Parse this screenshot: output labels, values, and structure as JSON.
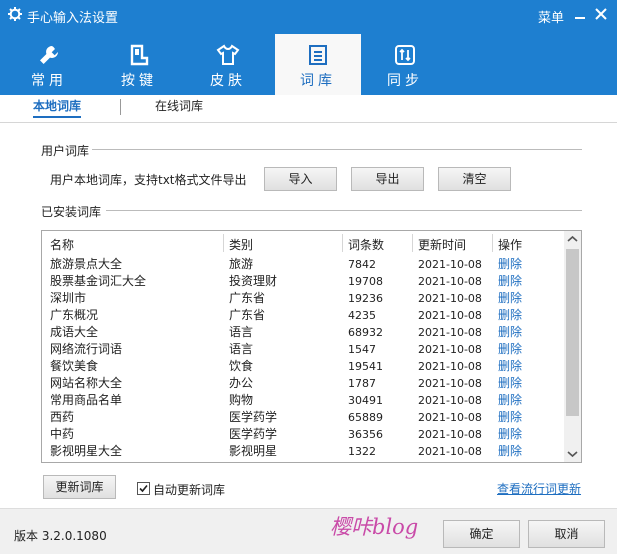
{
  "window": {
    "title": "手心输入法设置",
    "menu_label": "菜单",
    "brand_color": "#1e7fd0",
    "link_color": "#1e6ec0"
  },
  "tabs": [
    {
      "label": "常用",
      "icon": "wrench-icon",
      "active": false
    },
    {
      "label": "按键",
      "icon": "keyboard-icon",
      "active": false
    },
    {
      "label": "皮肤",
      "icon": "shirt-icon",
      "active": false
    },
    {
      "label": "词库",
      "icon": "document-icon",
      "active": true
    },
    {
      "label": "同步",
      "icon": "sync-icon",
      "active": false
    }
  ],
  "subtabs": [
    {
      "label": "本地词库",
      "active": true
    },
    {
      "label": "在线词库",
      "active": false
    }
  ],
  "user_lexicon": {
    "title": "用户词库",
    "description": "用户本地词库，支持txt格式文件导出",
    "import_label": "导入",
    "export_label": "导出",
    "clear_label": "清空"
  },
  "installed": {
    "title": "已安装词库",
    "columns": [
      "名称",
      "类别",
      "词条数",
      "更新时间",
      "操作"
    ],
    "rows": [
      {
        "name": "旅游景点大全",
        "category": "旅游",
        "count": "7842",
        "date": "2021-10-08",
        "action": "删除"
      },
      {
        "name": "股票基金词汇大全",
        "category": "投资理财",
        "count": "19708",
        "date": "2021-10-08",
        "action": "删除"
      },
      {
        "name": "深圳市",
        "category": "广东省",
        "count": "19236",
        "date": "2021-10-08",
        "action": "删除"
      },
      {
        "name": "广东概况",
        "category": "广东省",
        "count": "4235",
        "date": "2021-10-08",
        "action": "删除"
      },
      {
        "name": "成语大全",
        "category": "语言",
        "count": "68932",
        "date": "2021-10-08",
        "action": "删除"
      },
      {
        "name": "网络流行词语",
        "category": "语言",
        "count": "1547",
        "date": "2021-10-08",
        "action": "删除"
      },
      {
        "name": "餐饮美食",
        "category": "饮食",
        "count": "19541",
        "date": "2021-10-08",
        "action": "删除"
      },
      {
        "name": "网站名称大全",
        "category": "办公",
        "count": "1787",
        "date": "2021-10-08",
        "action": "删除"
      },
      {
        "name": "常用商品名单",
        "category": "购物",
        "count": "30491",
        "date": "2021-10-08",
        "action": "删除"
      },
      {
        "name": "西药",
        "category": "医学药学",
        "count": "65889",
        "date": "2021-10-08",
        "action": "删除"
      },
      {
        "name": "中药",
        "category": "医学药学",
        "count": "36356",
        "date": "2021-10-08",
        "action": "删除"
      },
      {
        "name": "影视明星大全",
        "category": "影视明星",
        "count": "1322",
        "date": "2021-10-08",
        "action": "删除"
      }
    ],
    "update_label": "更新词库",
    "auto_update_label": "自动更新词库",
    "auto_update_checked": true,
    "view_popular_link": "查看流行词更新"
  },
  "footer": {
    "version": "版本 3.2.0.1080",
    "watermark": "樱咔blog",
    "ok_label": "确定",
    "cancel_label": "取消"
  }
}
